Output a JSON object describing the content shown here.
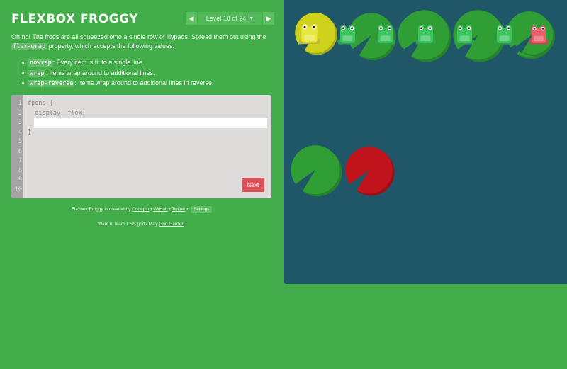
{
  "app": {
    "title": "FLEXBOX FROGGY"
  },
  "level_nav": {
    "prev_icon": "triangle-left",
    "label": "Level 18 of 24",
    "dropdown_icon": "triangle-down",
    "next_icon": "triangle-right"
  },
  "instructions": {
    "intro_before": "Oh no! The frogs are all squeezed onto a single row of lilypads. Spread them out using the ",
    "intro_property": "flex-wrap",
    "intro_after": " property, which accepts the following values:",
    "options": [
      {
        "value": "nowrap",
        "description": ": Every item is fit to a single line."
      },
      {
        "value": "wrap",
        "description": ": Items wrap around to additional lines."
      },
      {
        "value": "wrap-reverse",
        "description": ": Items wrap around to additional lines in reverse."
      }
    ]
  },
  "editor": {
    "line_numbers": [
      "1",
      "2",
      "3",
      "4",
      "5",
      "6",
      "7",
      "8",
      "9",
      "10"
    ],
    "code_before": [
      "#pond {",
      "  display: flex;"
    ],
    "input_value": "",
    "code_after": "}",
    "next_label": "Next"
  },
  "credits": {
    "prefix": "Flexbox Froggy is created by ",
    "codepip": "Codepip",
    "sep1": " • ",
    "github": "GitHub",
    "sep2": " • ",
    "twitter": "Twitter",
    "sep3": " • ",
    "settings": "Settings"
  },
  "promo": {
    "prefix": "Want to learn CSS grid? Play ",
    "link": "Grid Garden",
    "suffix": "."
  },
  "colors": {
    "background_green": "#42ad49",
    "pond_blue": "#1f5768",
    "next_button_red": "#d9535a",
    "frog_green": "#3cc45f",
    "frog_yellow": "#e8e642",
    "frog_red": "#e95e6a",
    "lilypad_green": "#2e9e35",
    "lilypad_yellow": "#cfd21c",
    "lilypad_red": "#c0141d"
  },
  "frogs": [
    {
      "color": "yellow"
    },
    {
      "color": "green"
    },
    {
      "color": "green"
    },
    {
      "color": "green"
    },
    {
      "color": "green"
    },
    {
      "color": "green"
    },
    {
      "color": "red"
    }
  ],
  "lilypads": [
    {
      "color": "yellow"
    },
    {
      "color": "green"
    },
    {
      "color": "green"
    },
    {
      "color": "green"
    },
    {
      "color": "green"
    },
    {
      "color": "green"
    },
    {
      "color": "green"
    },
    {
      "color": "green"
    },
    {
      "color": "red"
    }
  ]
}
